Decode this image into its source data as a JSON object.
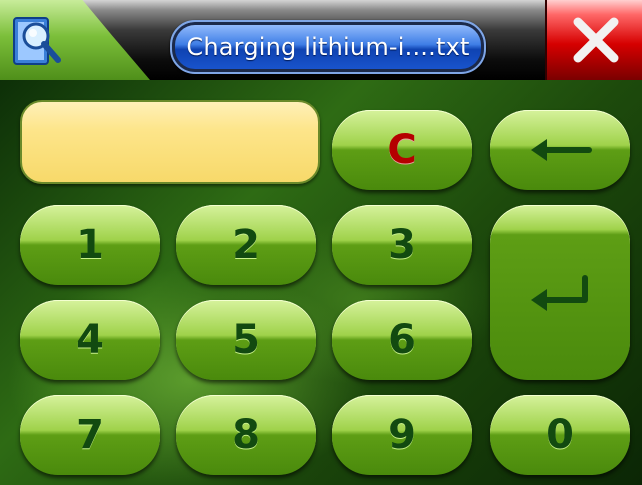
{
  "window": {
    "title": "Charging lithium-i....txt",
    "app_icon": "search-document-icon",
    "close_icon": "close-icon"
  },
  "display": {
    "value": ""
  },
  "keys": {
    "clear": "C",
    "backspace_icon": "backspace-arrow-icon",
    "enter_icon": "enter-return-icon",
    "digits": [
      "1",
      "2",
      "3",
      "4",
      "5",
      "6",
      "7",
      "8",
      "9",
      "0"
    ]
  },
  "colors": {
    "accent_green": "#6fb21f",
    "display_yellow": "#fde58a",
    "title_blue": "#1a56d0",
    "close_red": "#d60000",
    "digit_text": "#124a10",
    "clear_text": "#b50000"
  }
}
